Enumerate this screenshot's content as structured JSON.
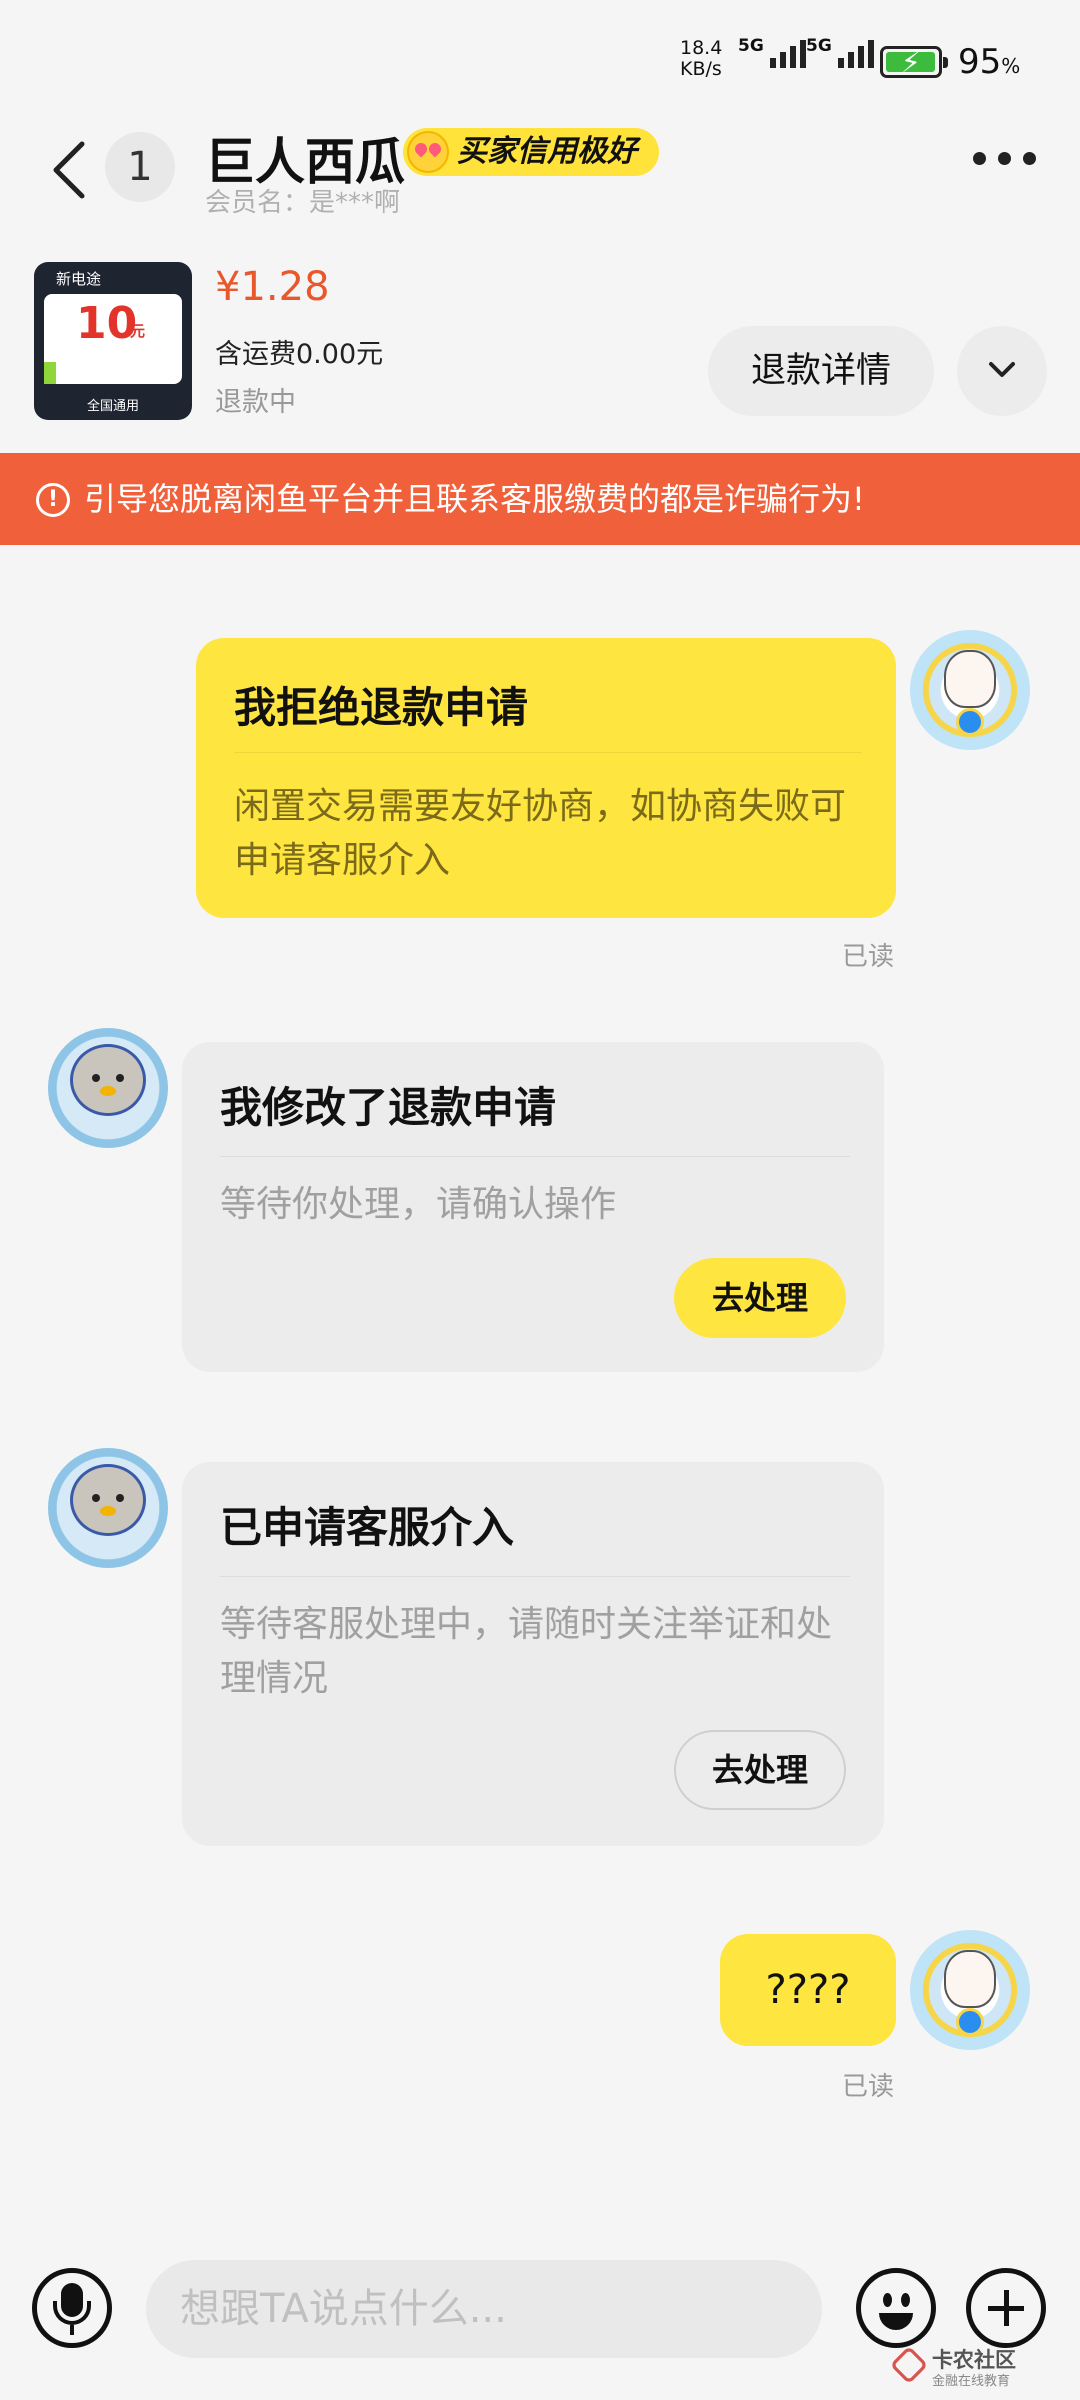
{
  "status_bar": {
    "speed_value": "18.4",
    "speed_unit": "KB/s",
    "network_1": "5G",
    "network_2": "5G",
    "battery_pct": "95",
    "battery_pct_sign": "%",
    "battery_level": 0.95,
    "battery_color": "#3dbb3d"
  },
  "header": {
    "back_icon": "chevron-left-icon",
    "unread_count": "1",
    "title": "巨人西瓜",
    "credit_badge": "买家信用极好",
    "member_label": "会员名：是***啊",
    "more_icon": "more-dots-icon"
  },
  "product": {
    "thumb_brand": "新电途",
    "thumb_amount": "10",
    "thumb_unit": "元",
    "thumb_footer": "全国通用",
    "price": "¥1.28",
    "shipping": "含运费0.00元",
    "status": "退款中",
    "refund_button": "退款详情",
    "expand_icon": "chevron-down-icon"
  },
  "warning": {
    "icon": "exclamation-circle-icon",
    "text": "引导您脱离闲鱼平台并且联系客服缴费的都是诈骗行为!"
  },
  "messages": [
    {
      "sender": "me",
      "title": "我拒绝退款申请",
      "body": "闲置交易需要友好协商，如协商失败可申请客服介入",
      "read": "已读"
    },
    {
      "sender": "other",
      "title": "我修改了退款申请",
      "body": "等待你处理，请确认操作",
      "action": "去处理"
    },
    {
      "sender": "other",
      "title": "已申请客服介入",
      "body": "等待客服处理中，请随时关注举证和处理情况",
      "action": "去处理"
    },
    {
      "sender": "me",
      "text": "????",
      "read": "已读"
    }
  ],
  "input": {
    "placeholder": "想跟TA说点什么..."
  },
  "watermark": {
    "main": "卡农社区",
    "sub": "金融在线教育"
  },
  "colors": {
    "accent_yellow": "#ffe53f",
    "warning_orange": "#f0603a",
    "price_orange": "#e9582c"
  }
}
